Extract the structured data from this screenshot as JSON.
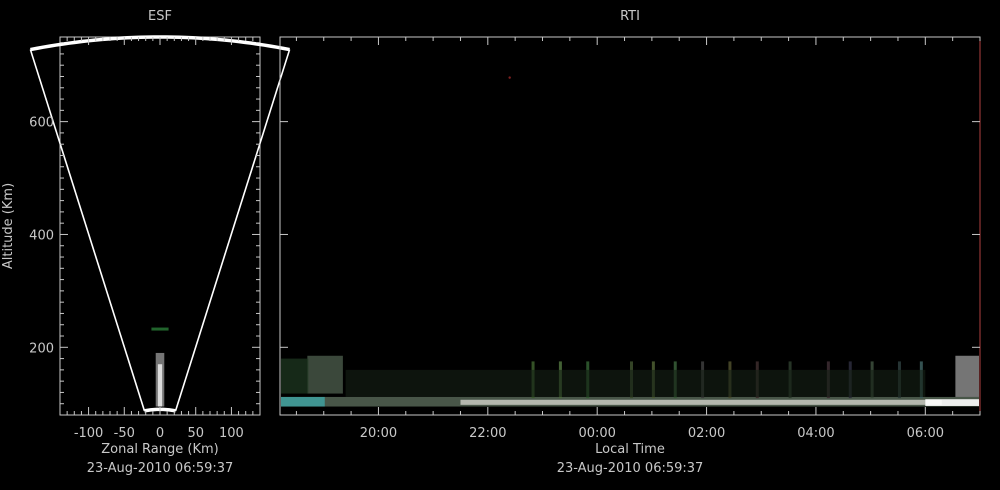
{
  "chart_data": [
    {
      "type": "heatmap",
      "title": "ESF",
      "xlabel": "Zonal Range (Km)",
      "ylabel": "Altitude (Km)",
      "timestamp": "23-Aug-2010 06:59:37",
      "xlim": [
        -140,
        140
      ],
      "ylim": [
        80,
        750
      ],
      "xticks": [
        -100,
        -50,
        0,
        50,
        100
      ],
      "yticks": [
        200,
        400,
        600
      ],
      "fan": {
        "half_angle_deg": 14,
        "r_min": 90,
        "r_max": 750
      },
      "echo_altitude_range": [
        95,
        190
      ]
    },
    {
      "type": "heatmap",
      "title": "RTI",
      "xlabel": "Local Time",
      "timestamp": "23-Aug-2010 06:59:37",
      "xlim_hours": [
        18.2,
        31.0
      ],
      "ylim": [
        80,
        750
      ],
      "yticks": [
        200,
        400,
        600
      ],
      "xticks": [
        {
          "value": 20,
          "label": "20:00"
        },
        {
          "value": 22,
          "label": "22:00"
        },
        {
          "value": 24,
          "label": "00:00"
        },
        {
          "value": 26,
          "label": "02:00"
        },
        {
          "value": 28,
          "label": "04:00"
        },
        {
          "value": 30,
          "label": "06:00"
        }
      ],
      "echo_layer_altitude": [
        95,
        185
      ]
    }
  ],
  "colors": {
    "axis": "#c8c8c8",
    "frame": "#ffffff",
    "echo_white": "#e8e8e8",
    "echo_green": "#2f8f3f",
    "echo_teal": "#3fa0a0"
  }
}
